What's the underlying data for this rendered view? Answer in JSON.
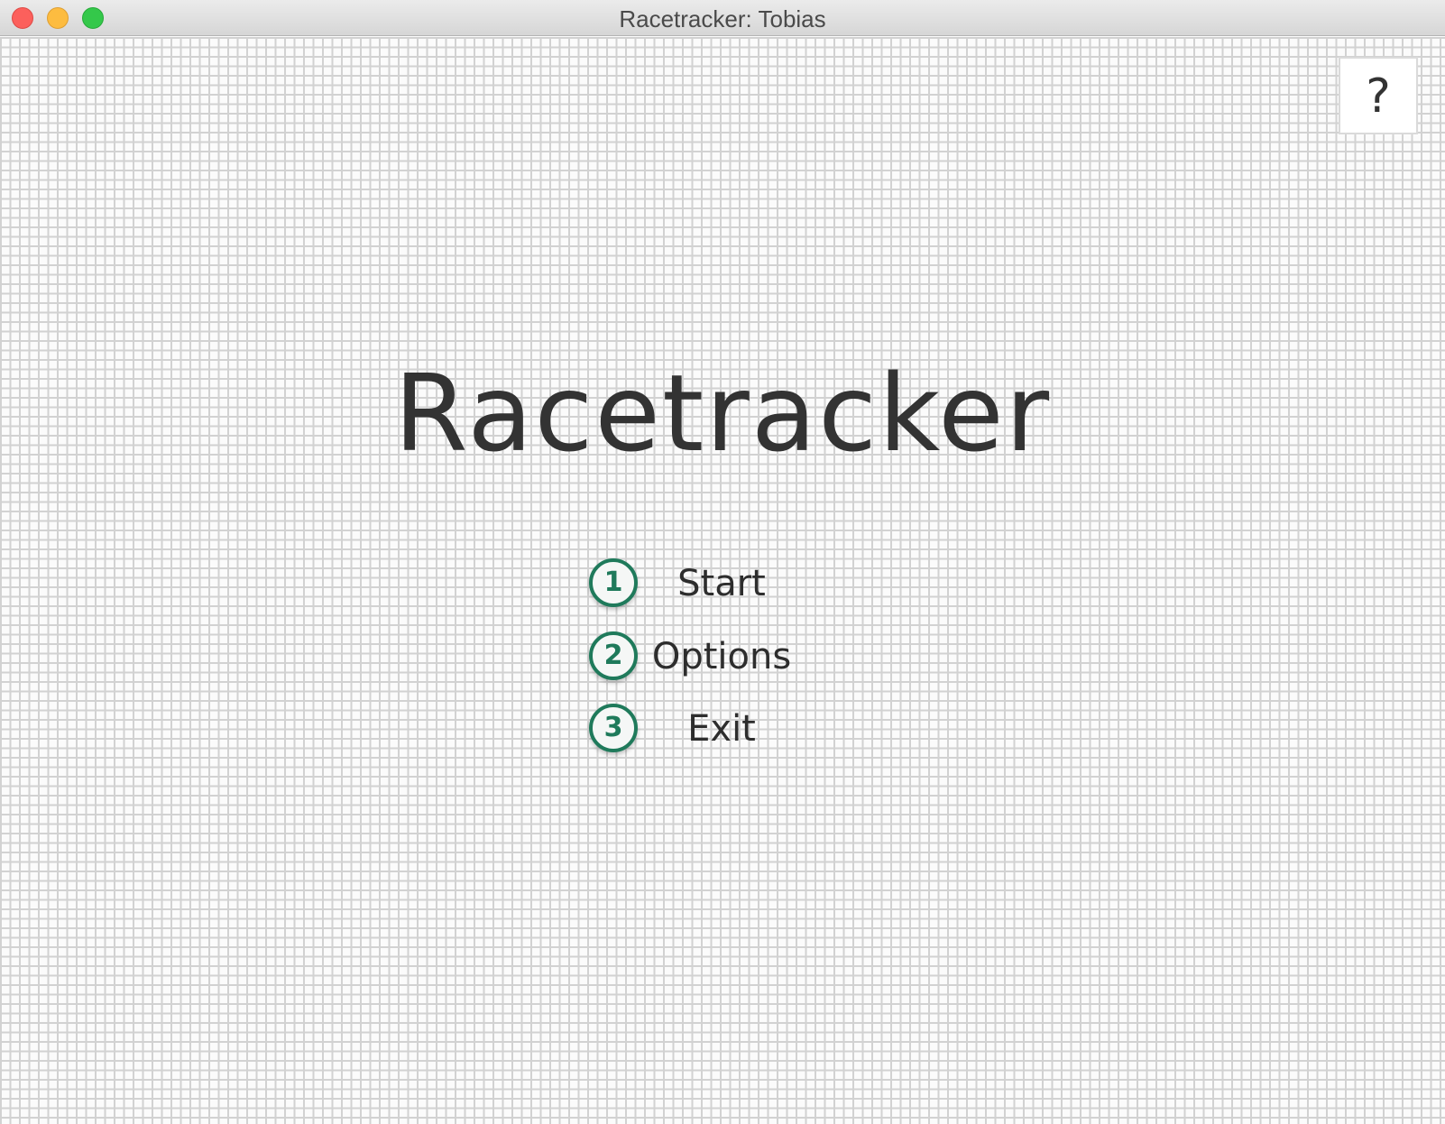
{
  "window": {
    "title": "Racetracker: Tobias"
  },
  "help": {
    "label": "?"
  },
  "game": {
    "title": "Racetracker"
  },
  "menu": {
    "items": [
      {
        "number": "1",
        "label": "Start"
      },
      {
        "number": "2",
        "label": "Options"
      },
      {
        "number": "3",
        "label": "Exit"
      }
    ]
  },
  "colors": {
    "badge_accent": "#1f7a5b",
    "grid_line": "#d2d2d2",
    "title_text": "#333333"
  }
}
